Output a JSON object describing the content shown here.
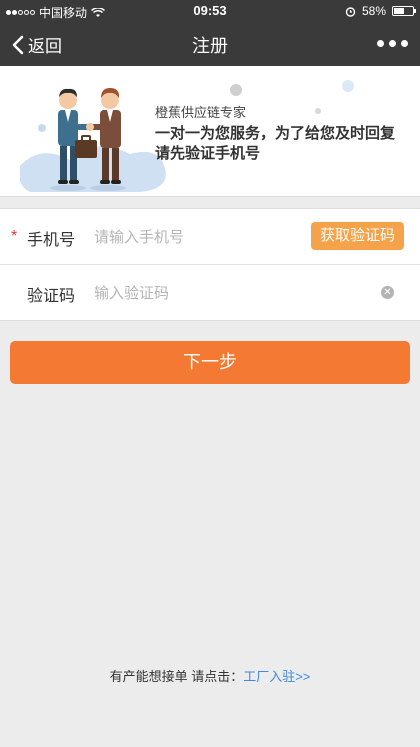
{
  "status_bar": {
    "carrier": "中国移动",
    "time": "09:53",
    "battery_percent": "58%",
    "battery_level": 0.58
  },
  "nav": {
    "back_label": "返回",
    "title": "注册"
  },
  "banner": {
    "subtitle": "橙蕉供应链专家",
    "headline": "一对一为您服务，为了给您及时回复请先验证手机号"
  },
  "form": {
    "phone": {
      "label": "手机号",
      "required_mark": "*",
      "placeholder": "请输入手机号",
      "value": "",
      "get_code_label": "获取验证码"
    },
    "code": {
      "label": "验证码",
      "placeholder": "输入验证码",
      "value": ""
    }
  },
  "next_button_label": "下一步",
  "footer": {
    "prompt": "有产能想接单 请点击：",
    "link_label": "工厂入驻>>"
  },
  "colors": {
    "accent": "#f47a33",
    "code_button": "#f5a34a",
    "link": "#3d8bd9",
    "nav_bg": "#3a3a3a"
  }
}
